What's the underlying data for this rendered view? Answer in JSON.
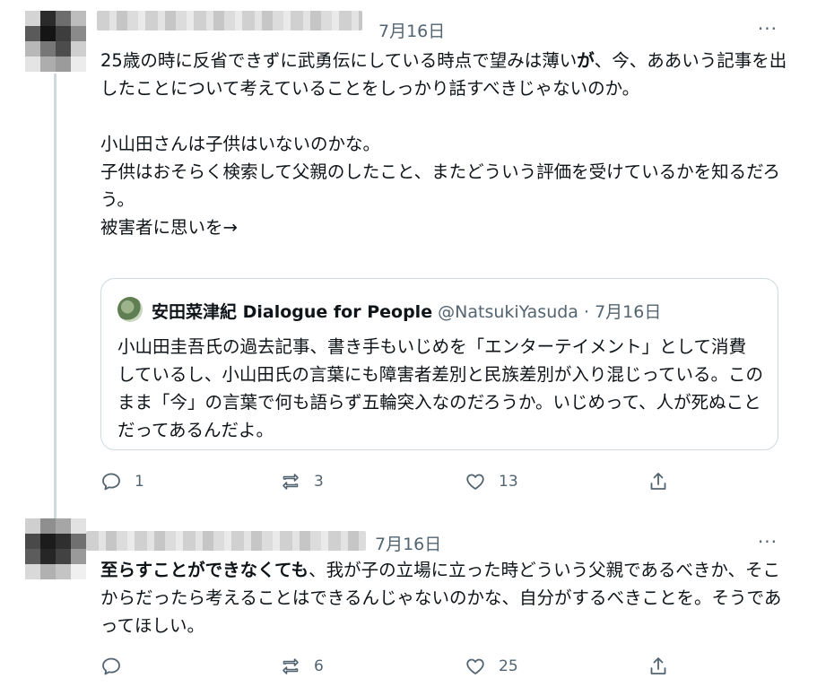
{
  "tweet1": {
    "date": "7月16日",
    "more": "···",
    "body": [
      {
        "text": "25歳の時に反省できずに武勇伝にしている時点で望みは薄い",
        "bold": false
      },
      {
        "text": "が",
        "bold": true
      },
      {
        "text": "、今、ああいう記事を出したことについて考えていることをしっかり話すべきじゃないのか。\n\n小山田さんは子供はいないのかな。\n子供はおそらく検索して父親のしたこと、またどういう評価を受けているかを知るだろう。\n被害者に思いを→",
        "bold": false
      }
    ],
    "quote": {
      "name": "安田菜津紀 Dialogue for People",
      "handle": "@NatsukiYasuda",
      "sep": " · ",
      "date": "7月16日",
      "text": "小山田圭吾氏の過去記事、書き手もいじめを「エンターテイメント」として消費しているし、小山田氏の言葉にも障害者差別と民族差別が入り混じっている。このまま「今」の言葉で何も語らず五輪突入なのだろうか。いじめって、人が死ぬことだってあるんだよ。"
    },
    "replies": "1",
    "retweets": "3",
    "likes": "13"
  },
  "tweet2": {
    "date": "7月16日",
    "more": "···",
    "body": [
      {
        "text": "至らすことができなくても",
        "bold": true
      },
      {
        "text": "、我が子の立場に立った時どういう父親であるべきか、そこからだったら考えることはできるんじゃないのかな、自分がするべきことを。そうであってほしい。",
        "bold": false
      }
    ],
    "replies": "",
    "retweets": "6",
    "likes": "25"
  },
  "colors": {
    "text": "#0f1419",
    "muted": "#536471",
    "border": "#cfd9de"
  },
  "icons": [
    "reply-icon",
    "retweet-icon",
    "like-icon",
    "share-icon",
    "more-icon"
  ]
}
